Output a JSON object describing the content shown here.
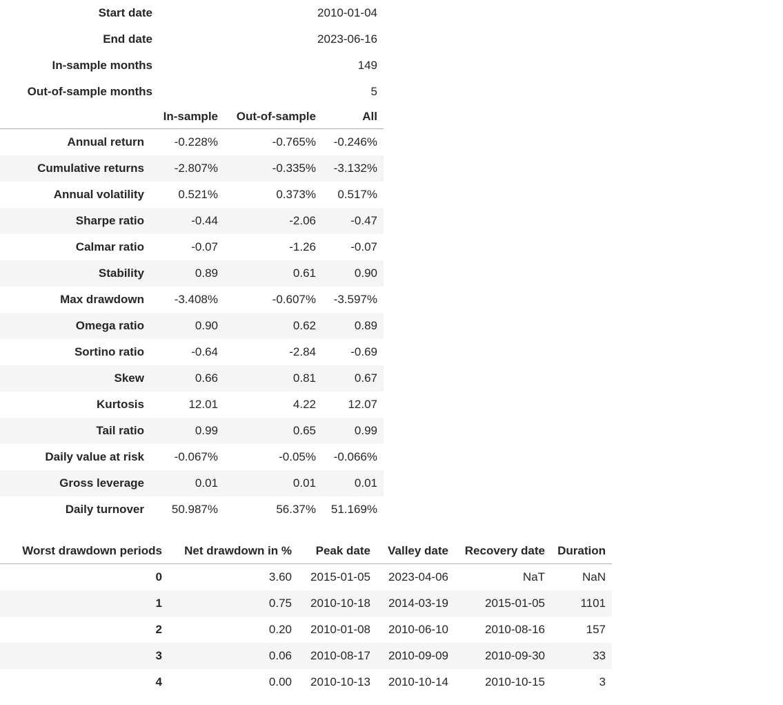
{
  "summary": {
    "rows": [
      {
        "label": "Start date",
        "value": "2010-01-04"
      },
      {
        "label": "End date",
        "value": "2023-06-16"
      },
      {
        "label": "In-sample months",
        "value": "149"
      },
      {
        "label": "Out-of-sample months",
        "value": "5"
      }
    ]
  },
  "metrics": {
    "columns": [
      "In-sample",
      "Out-of-sample",
      "All"
    ],
    "rows": [
      {
        "label": "Annual return",
        "in_sample": "-0.228%",
        "out_of_sample": "-0.765%",
        "all": "-0.246%"
      },
      {
        "label": "Cumulative returns",
        "in_sample": "-2.807%",
        "out_of_sample": "-0.335%",
        "all": "-3.132%"
      },
      {
        "label": "Annual volatility",
        "in_sample": "0.521%",
        "out_of_sample": "0.373%",
        "all": "0.517%"
      },
      {
        "label": "Sharpe ratio",
        "in_sample": "-0.44",
        "out_of_sample": "-2.06",
        "all": "-0.47"
      },
      {
        "label": "Calmar ratio",
        "in_sample": "-0.07",
        "out_of_sample": "-1.26",
        "all": "-0.07"
      },
      {
        "label": "Stability",
        "in_sample": "0.89",
        "out_of_sample": "0.61",
        "all": "0.90"
      },
      {
        "label": "Max drawdown",
        "in_sample": "-3.408%",
        "out_of_sample": "-0.607%",
        "all": "-3.597%"
      },
      {
        "label": "Omega ratio",
        "in_sample": "0.90",
        "out_of_sample": "0.62",
        "all": "0.89"
      },
      {
        "label": "Sortino ratio",
        "in_sample": "-0.64",
        "out_of_sample": "-2.84",
        "all": "-0.69"
      },
      {
        "label": "Skew",
        "in_sample": "0.66",
        "out_of_sample": "0.81",
        "all": "0.67"
      },
      {
        "label": "Kurtosis",
        "in_sample": "12.01",
        "out_of_sample": "4.22",
        "all": "12.07"
      },
      {
        "label": "Tail ratio",
        "in_sample": "0.99",
        "out_of_sample": "0.65",
        "all": "0.99"
      },
      {
        "label": "Daily value at risk",
        "in_sample": "-0.067%",
        "out_of_sample": "-0.05%",
        "all": "-0.066%"
      },
      {
        "label": "Gross leverage",
        "in_sample": "0.01",
        "out_of_sample": "0.01",
        "all": "0.01"
      },
      {
        "label": "Daily turnover",
        "in_sample": "50.987%",
        "out_of_sample": "56.37%",
        "all": "51.169%"
      }
    ]
  },
  "drawdown": {
    "columns": [
      "Worst drawdown periods",
      "Net drawdown in %",
      "Peak date",
      "Valley date",
      "Recovery date",
      "Duration"
    ],
    "rows": [
      {
        "index": "0",
        "net": "3.60",
        "peak": "2015-01-05",
        "valley": "2023-04-06",
        "recovery": "NaT",
        "duration": "NaN"
      },
      {
        "index": "1",
        "net": "0.75",
        "peak": "2010-10-18",
        "valley": "2014-03-19",
        "recovery": "2015-01-05",
        "duration": "1101"
      },
      {
        "index": "2",
        "net": "0.20",
        "peak": "2010-01-08",
        "valley": "2010-06-10",
        "recovery": "2010-08-16",
        "duration": "157"
      },
      {
        "index": "3",
        "net": "0.06",
        "peak": "2010-08-17",
        "valley": "2010-09-09",
        "recovery": "2010-09-30",
        "duration": "33"
      },
      {
        "index": "4",
        "net": "0.00",
        "peak": "2010-10-13",
        "valley": "2010-10-14",
        "recovery": "2010-10-15",
        "duration": "3"
      }
    ]
  },
  "colors": {
    "text": "#262626",
    "stripe": "#f5f5f5",
    "rule": "#b0b0b0",
    "background": "#ffffff"
  }
}
